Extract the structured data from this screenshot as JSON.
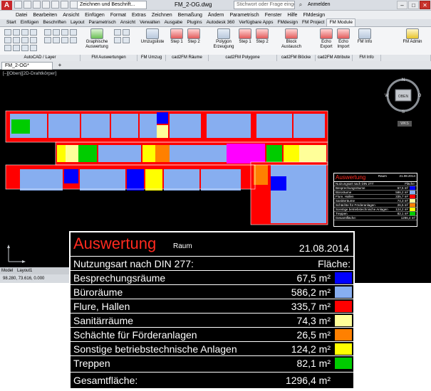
{
  "window": {
    "workspace": "Zeichnen und Beschrift...",
    "document_title": "FM_2-OG.dwg",
    "search_placeholder": "Stichwort oder Frage eingeben",
    "login_label": "Anmelden"
  },
  "menu": [
    "Datei",
    "Bearbeiten",
    "Ansicht",
    "Einfügen",
    "Format",
    "Extras",
    "Zeichnen",
    "Bemaßung",
    "Ändern",
    "Parametrisch",
    "Fenster",
    "Hilfe",
    "FMdesign"
  ],
  "ribbon_tabs": [
    "Start",
    "Einfügen",
    "Beschriften",
    "Layout",
    "Parametrisch",
    "Ansicht",
    "Verwalten",
    "Ausgabe",
    "Plugins",
    "Autodesk 360",
    "Verfügbare Apps",
    "FMdesign",
    "FM Project",
    "FM Module"
  ],
  "ribbon_active_tab": "FM Module",
  "ribbon_buttons": {
    "graphische_auswertung": "Graphische Auswertung",
    "umzugsliste": "Umzugsliste",
    "step1_a": "Step 1",
    "step2_a": "Step 2",
    "polygon_erzeugung": "Polygon Erzeugung",
    "step1_b": "Step 1",
    "step2_b": "Step 2",
    "block_austausch": "Block Austausch",
    "echo_export": "Echo Export",
    "echo_import": "Echo Import",
    "fm_info": "FM Info",
    "fm_admin": "FM Admin"
  },
  "ribbon_groups": [
    "AutoCAD / Layer",
    "FM Auswertungen",
    "FM Umzug",
    "cad2FM Räume",
    "cad2FM Polygone",
    "cad2FM Blöcke",
    "cad2FM Attribute",
    "FM Info"
  ],
  "document_tab": "FM_2-OG*",
  "viewport_label": "[–][Oben][2D-Drahtkörper]",
  "viewcube": {
    "face": "OBEN",
    "n": "N",
    "s": "S",
    "w": "W",
    "o": "O",
    "wcs": "WKS"
  },
  "layout_tabs": [
    "Model",
    "Layout1"
  ],
  "status_coords": "98.280, 73.616, 0.000",
  "legend": {
    "title": "Auswertung",
    "subtitle": "Raum",
    "date": "21.08.2014",
    "header_label": "Nutzungsart nach DIN 277:",
    "header_value": "Fläche:",
    "rows": [
      {
        "name": "Besprechungsräume",
        "value": "67,5 m²",
        "color": "#0000ff"
      },
      {
        "name": "Büroräume",
        "value": "586,2 m²",
        "color": "#87aef0"
      },
      {
        "name": "Flure, Hallen",
        "value": "335,7 m²",
        "color": "#ff0000"
      },
      {
        "name": "Sanitärräume",
        "value": "74,3 m²",
        "color": "#ffff99"
      },
      {
        "name": "Schächte für Förderanlagen",
        "value": "26,5 m²",
        "color": "#ff8000"
      },
      {
        "name": "Sonstige betriebstechnische Anlagen",
        "value": "124,2 m²",
        "color": "#ffff00"
      },
      {
        "name": "Treppen",
        "value": "82,1 m²",
        "color": "#00cc00"
      }
    ],
    "total_label": "Gesamtfläche:",
    "total_value": "1296,4 m²"
  }
}
